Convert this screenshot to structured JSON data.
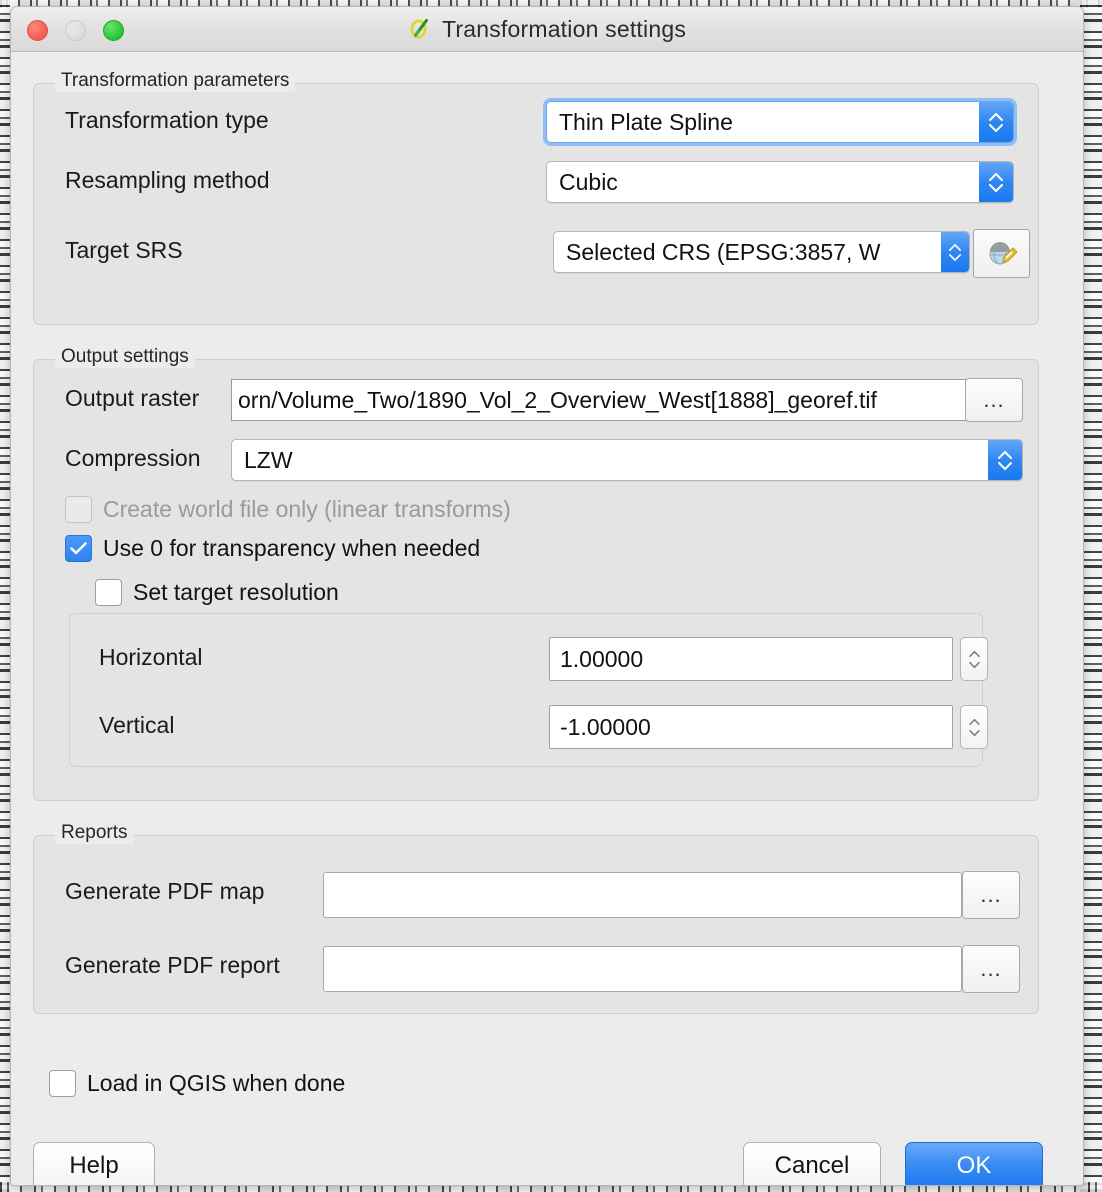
{
  "window": {
    "title": "Transformation settings",
    "app_icon": "qgis-icon",
    "controls": {
      "close": "close",
      "minimize": "minimize",
      "maximize": "maximize"
    }
  },
  "transformation_parameters": {
    "group_label": "Transformation parameters",
    "fields": [
      {
        "label": "Transformation type",
        "value": "Thin Plate Spline",
        "control": "combobox",
        "focused": true
      },
      {
        "label": "Resampling method",
        "value": "Cubic",
        "control": "combobox",
        "focused": false
      },
      {
        "label": "Target SRS",
        "value": "Selected CRS (EPSG:3857, W",
        "control": "combobox",
        "focused": false
      }
    ],
    "crs_button_icon": "globe-pencil-icon"
  },
  "output_settings": {
    "group_label": "Output settings",
    "output_raster": {
      "label": "Output raster",
      "value": "orn/Volume_Two/1890_Vol_2_Overview_West[1888]_georef.tif",
      "browse_label": "..."
    },
    "compression": {
      "label": "Compression",
      "value": "LZW"
    },
    "create_world_file": {
      "label": "Create world file only (linear transforms)",
      "checked": false,
      "enabled": false
    },
    "use_zero_transparency": {
      "label": "Use 0 for transparency when needed",
      "checked": true,
      "enabled": true
    },
    "set_target_resolution": {
      "label": "Set target resolution",
      "checked": false,
      "enabled": true
    },
    "resolution": {
      "horizontal": {
        "label": "Horizontal",
        "value": "1.00000"
      },
      "vertical": {
        "label": "Vertical",
        "value": "-1.00000"
      }
    }
  },
  "reports": {
    "group_label": "Reports",
    "pdf_map": {
      "label": "Generate PDF map",
      "value": "",
      "browse_label": "..."
    },
    "pdf_report": {
      "label": "Generate PDF report",
      "value": "",
      "browse_label": "..."
    }
  },
  "load_in_qgis": {
    "label": "Load in QGIS when done",
    "checked": false
  },
  "buttons": {
    "help": "Help",
    "cancel": "Cancel",
    "ok": "OK"
  },
  "colors": {
    "accent_blue": "#2f86f2",
    "primary_button": "#1b78ef",
    "checkbox_checked": "#2f82f0",
    "window_bg": "#ececec",
    "group_bg": "#e4e4e4",
    "disabled_text": "#9a9a9a"
  }
}
